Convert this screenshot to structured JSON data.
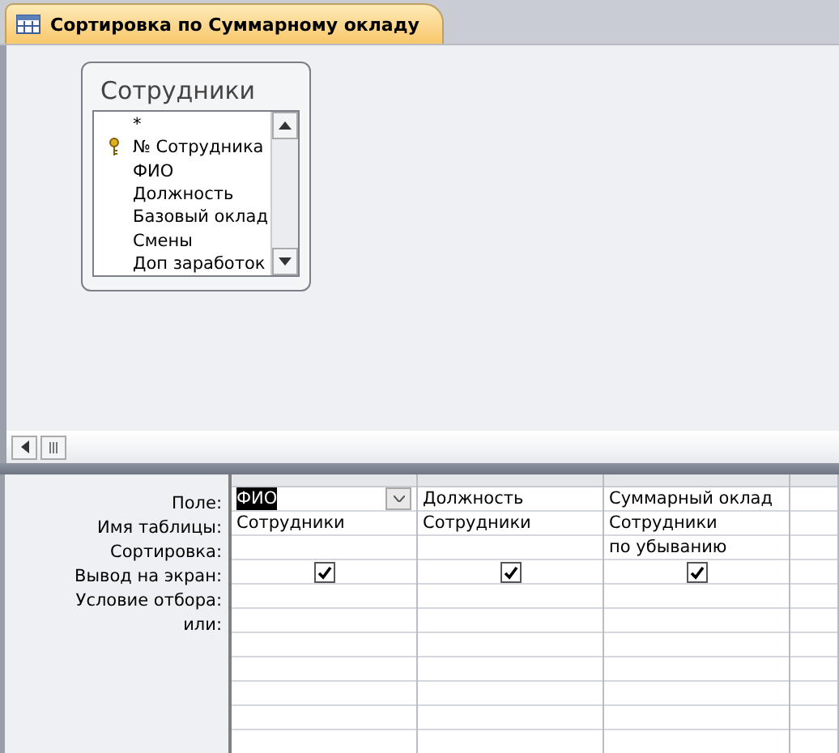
{
  "tab": {
    "title": "Сортировка по Суммарному окладу",
    "selected": true
  },
  "table_box": {
    "title": "Сотрудники",
    "fields": [
      {
        "name": "*",
        "primary_key": false
      },
      {
        "name": "№ Сотрудника",
        "primary_key": true
      },
      {
        "name": "ФИО",
        "primary_key": false
      },
      {
        "name": "Должность",
        "primary_key": false
      },
      {
        "name": "Базовый оклад",
        "primary_key": false
      },
      {
        "name": "Смены",
        "primary_key": false
      },
      {
        "name": "Доп заработок",
        "primary_key": false
      }
    ]
  },
  "grid": {
    "row_labels": [
      "Поле:",
      "Имя таблицы:",
      "Сортировка:",
      "Вывод на экран:",
      "Условие отбора:",
      "или:"
    ],
    "columns": [
      {
        "field": "ФИО",
        "table": "Сотрудники",
        "show": true,
        "selected": true
      },
      {
        "field": "Должность",
        "table": "Сотрудники",
        "show": true,
        "selected": false
      },
      {
        "field": "Суммарный оклад",
        "table": "Сотрудники",
        "sort": "по убыванию",
        "show": true,
        "selected": false
      }
    ]
  }
}
